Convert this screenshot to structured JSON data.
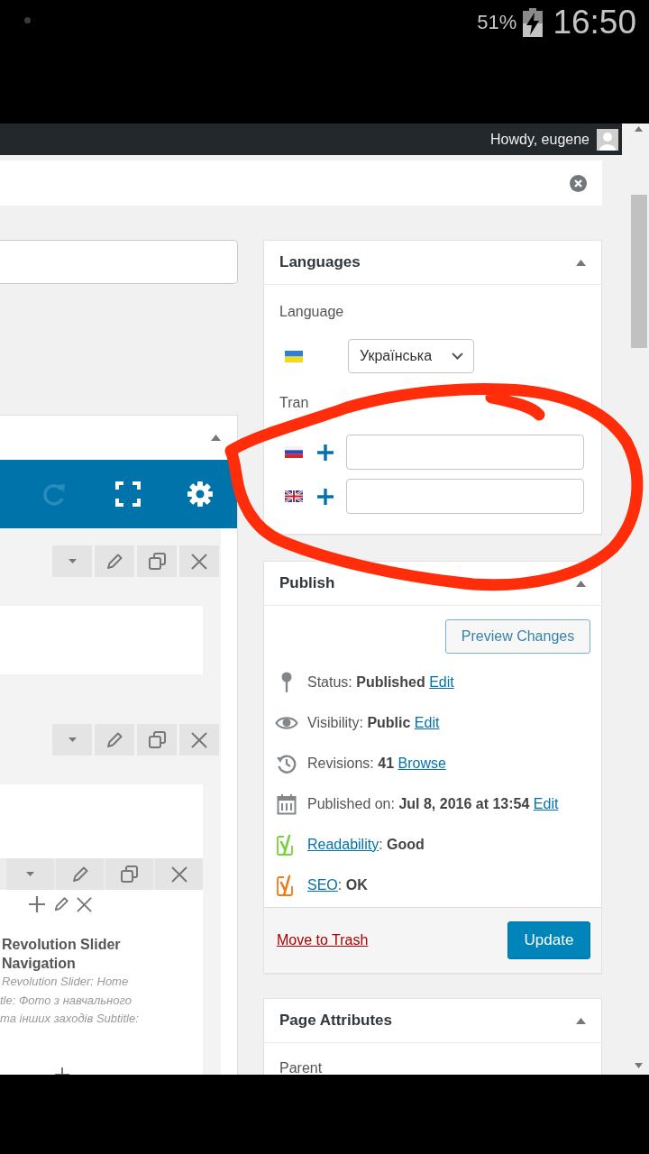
{
  "status_bar": {
    "battery": "51%",
    "time": "16:50"
  },
  "admin_bar": {
    "greeting": "Howdy, eugene"
  },
  "builder": {
    "widget": {
      "title": "Revolution Slider Navigation",
      "description": [
        "Revolution Slider: Home",
        "tle: Фото з навчального",
        "та інших заходів Subtitle:"
      ]
    }
  },
  "languages": {
    "title": "Languages",
    "language_label": "Language",
    "language": {
      "kind": "ua",
      "value": "Українська"
    },
    "translations_label": "Tran",
    "translations": [
      {
        "kind": "ru"
      },
      {
        "kind": "gb"
      }
    ]
  },
  "publish": {
    "title": "Publish",
    "preview_button": "Preview Changes",
    "rows": [
      {
        "kind": "status",
        "text": "Status: **Published**",
        "link": "Edit"
      },
      {
        "kind": "visibility",
        "text": "Visibility: **Public**",
        "link": "Edit"
      },
      {
        "kind": "revisions",
        "text": "Revisions: **41**",
        "link": "Browse"
      },
      {
        "kind": "date",
        "text": "Published on: **Jul 8, 2016 at 13:54**",
        "link": "Edit"
      },
      {
        "kind": "score",
        "color": "#7ad03a",
        "link": "Readability",
        "text": ": **Good**"
      },
      {
        "kind": "score",
        "color": "#ee7c1b",
        "link": "SEO",
        "text": ": **OK**"
      }
    ],
    "trash_link": "Move to Trash",
    "update_button": "Update"
  },
  "page_attributes": {
    "title": "Page Attributes",
    "parent_label": "Parent"
  }
}
